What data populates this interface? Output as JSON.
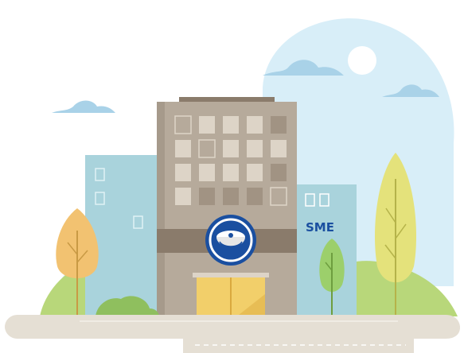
{
  "scene": {
    "sign_text": "SME",
    "logo_icon": "satellite-dish-logo-icon",
    "colors": {
      "sky_blob": "#d8eef8",
      "cloud": "#a9d2e8",
      "main_building": "#b6aa9b",
      "main_building_dark": "#9a8c7c",
      "building_band": "#8a7b6b",
      "window_light": "#ddd4c7",
      "window_dark": "#a19383",
      "side_building": "#a9d3dc",
      "side_building_window": "#c8e6ec",
      "door_glass": "#f2cf6a",
      "logo_ring": "#1a4fa0",
      "sign_text": "#1a4fa0",
      "ground": "#e5dfd4",
      "grass": "#b8d77a",
      "tree_orange": "#f2c271",
      "tree_yellow": "#e4e27b",
      "tree_green": "#9ccf6b"
    }
  }
}
